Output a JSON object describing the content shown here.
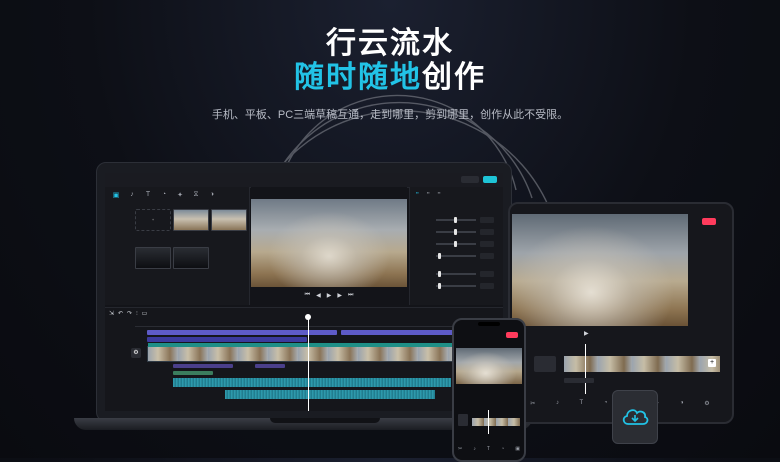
{
  "hero": {
    "line1": "行云流水",
    "line2_accent": "随时随地",
    "line2_plain": "创作",
    "subtitle": "手机、平板、PC三端草稿互通，走到哪里，剪到哪里，创作从此不受限。"
  },
  "colors": {
    "accent": "#22c3e6",
    "export_red": "#ff3b5c",
    "export_cyan": "#1ec4d6",
    "background": "#0d0f16"
  },
  "icons": {
    "cloud": "cloud-sync-icon",
    "play": "play-icon",
    "add": "plus-icon"
  }
}
